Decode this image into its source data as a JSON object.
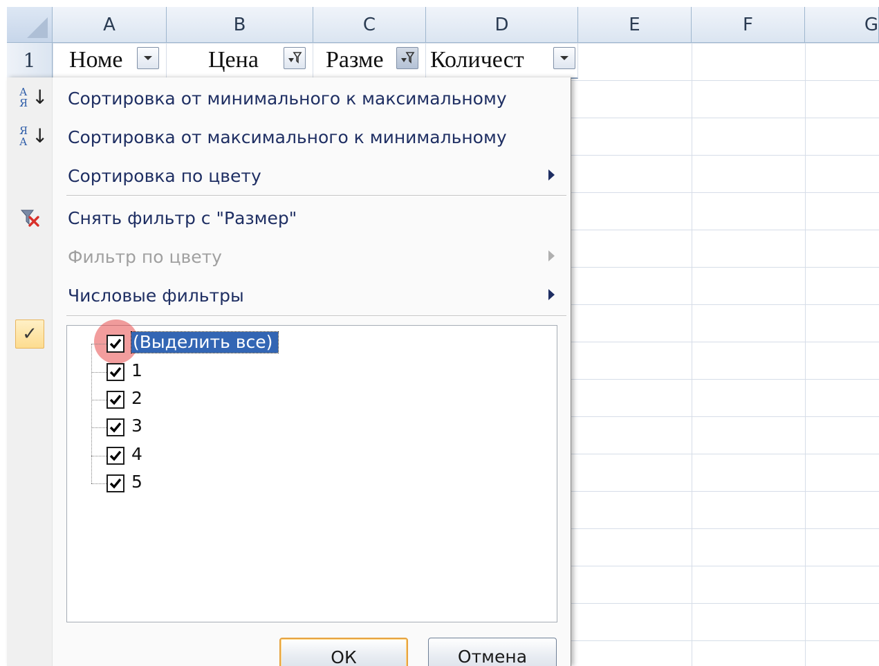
{
  "columns": [
    "A",
    "B",
    "C",
    "D",
    "E",
    "F",
    "G"
  ],
  "rows": [
    "1"
  ],
  "header_row": {
    "a": "Номе",
    "b": "Цена",
    "c": "Разме",
    "d": "Количест"
  },
  "menu": {
    "sort_asc": "Сортировка от минимального к максимальному",
    "sort_desc": "Сортировка от максимального к минимальному",
    "sort_by_color": "Сортировка по цвету",
    "clear_filter": "Снять фильтр с \"Размер\"",
    "filter_by_color": "Фильтр по цвету",
    "number_filters": "Числовые фильтры"
  },
  "list": {
    "select_all": "(Выделить все)",
    "items": [
      "1",
      "2",
      "3",
      "4",
      "5"
    ]
  },
  "buttons": {
    "ok": "ОК",
    "cancel": "Отмена"
  },
  "colors": {
    "highlight": "#3366b4",
    "menu_text": "#1f2f63",
    "disabled_text": "#a0a0a0",
    "cursor_halo": "#e63c3c"
  }
}
